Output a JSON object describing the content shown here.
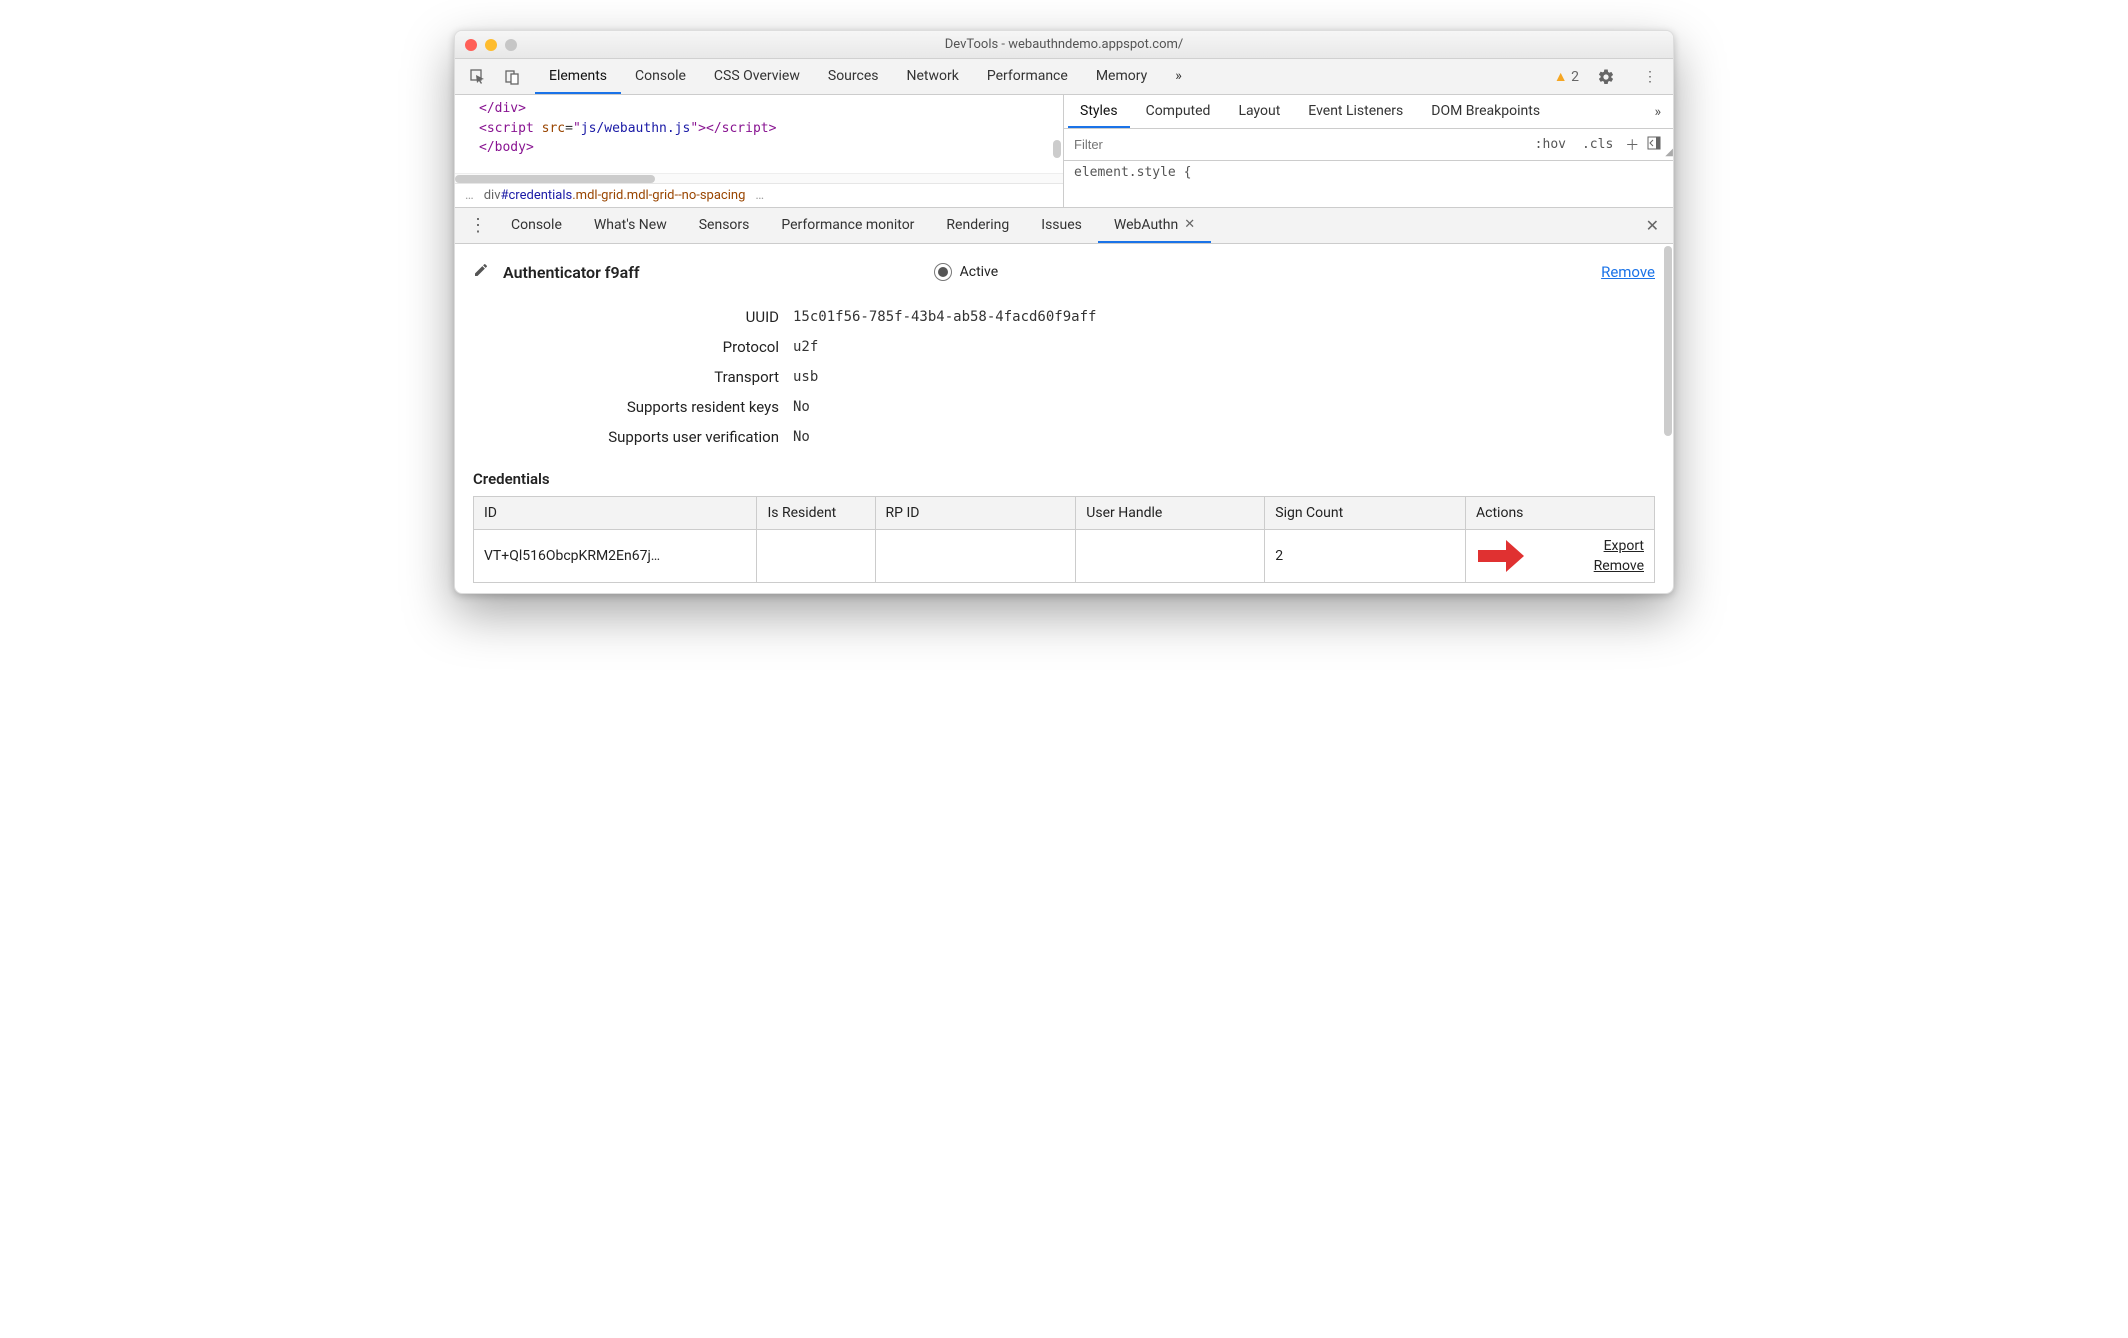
{
  "window": {
    "title": "DevTools - webauthndemo.appspot.com/"
  },
  "toolbar": {
    "tabs": [
      "Elements",
      "Console",
      "CSS Overview",
      "Sources",
      "Network",
      "Performance",
      "Memory"
    ],
    "activeIndex": 0,
    "overflow": "»",
    "warning_count": "2"
  },
  "code": {
    "line1_close": "</div>",
    "line2_open": "<script ",
    "line2_attr": "src",
    "line2_eq": "=",
    "line2_q": "\"",
    "line2_val": "js/webauthn.js",
    "line2_close": "></script>",
    "line3": "</body>"
  },
  "breadcrumb": {
    "dots_left": "…",
    "tag": "div",
    "id": "#credentials",
    "classes": ".mdl-grid.mdl-grid--no-spacing",
    "dots_right": "…"
  },
  "styles": {
    "tabs": [
      "Styles",
      "Computed",
      "Layout",
      "Event Listeners",
      "DOM Breakpoints"
    ],
    "activeIndex": 0,
    "overflow": "»",
    "filter_placeholder": "Filter",
    "hov": ":hov",
    "cls": ".cls",
    "rule": "element.style {"
  },
  "drawer": {
    "tabs": [
      "Console",
      "What's New",
      "Sensors",
      "Performance monitor",
      "Rendering",
      "Issues",
      "WebAuthn"
    ],
    "activeIndex": 6
  },
  "authenticator": {
    "name": "Authenticator f9aff",
    "active_label": "Active",
    "remove": "Remove",
    "props": [
      {
        "label": "UUID",
        "value": "15c01f56-785f-43b4-ab58-4facd60f9aff"
      },
      {
        "label": "Protocol",
        "value": "u2f"
      },
      {
        "label": "Transport",
        "value": "usb"
      },
      {
        "label": "Supports resident keys",
        "value": "No"
      },
      {
        "label": "Supports user verification",
        "value": "No"
      }
    ]
  },
  "credentials": {
    "title": "Credentials",
    "columns": [
      "ID",
      "Is Resident",
      "RP ID",
      "User Handle",
      "Sign Count",
      "Actions"
    ],
    "rows": [
      {
        "id": "VT+Ql516ObcpKRM2En67j…",
        "isResident": "",
        "rpid": "",
        "userHandle": "",
        "signCount": "2"
      }
    ],
    "actions": {
      "export": "Export",
      "remove": "Remove"
    }
  }
}
